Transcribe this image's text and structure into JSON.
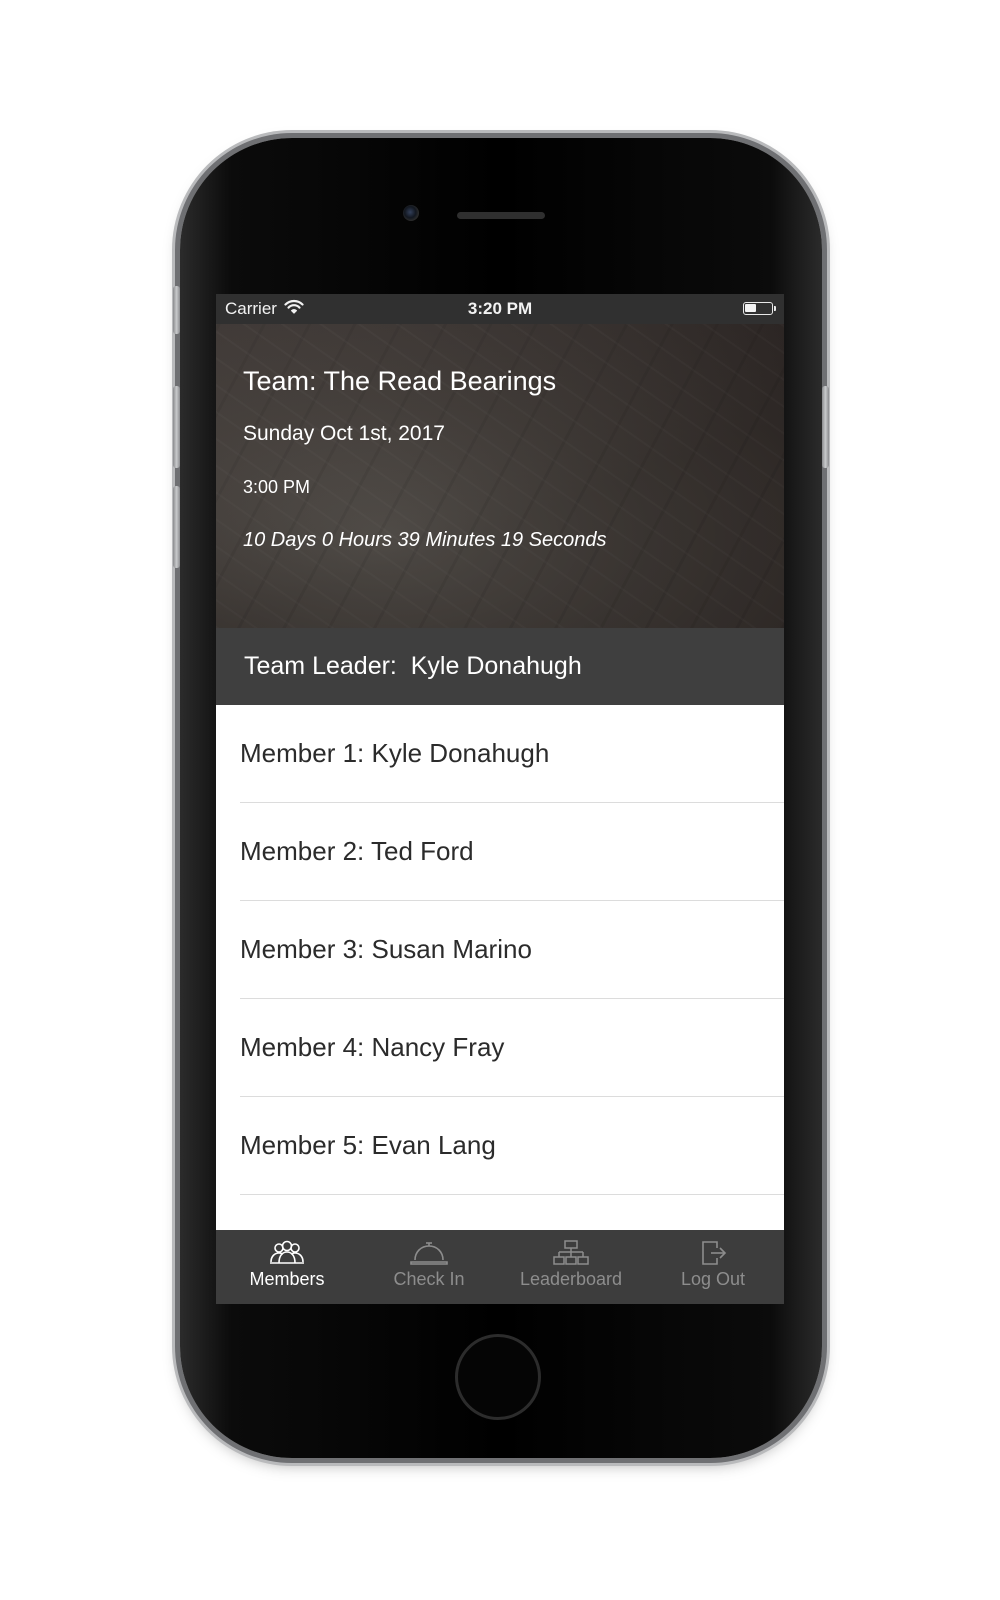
{
  "status_bar": {
    "carrier": "Carrier",
    "time": "3:20 PM",
    "battery_level": 0.45
  },
  "hero": {
    "team": "Team: The Read Bearings",
    "date": "Sunday Oct 1st, 2017",
    "time": "3:00 PM",
    "countdown": "10 Days 0 Hours 39 Minutes 19 Seconds"
  },
  "leader": {
    "label": "Team Leader:  Kyle Donahugh"
  },
  "members": [
    {
      "label": "Member 1: Kyle Donahugh"
    },
    {
      "label": "Member 2: Ted Ford"
    },
    {
      "label": "Member 3: Susan Marino"
    },
    {
      "label": "Member 4: Nancy Fray"
    },
    {
      "label": "Member 5: Evan Lang"
    }
  ],
  "tabs": [
    {
      "label": "Members",
      "icon": "members-icon",
      "active": true
    },
    {
      "label": "Check In",
      "icon": "bell-icon",
      "active": false
    },
    {
      "label": "Leaderboard",
      "icon": "hierarchy-icon",
      "active": false
    },
    {
      "label": "Log Out",
      "icon": "logout-icon",
      "active": false
    }
  ],
  "colors": {
    "status_bar": "#303030",
    "leader_bar": "#3f3f3f",
    "tab_bar": "#3d3d3d",
    "tab_active": "#ffffff",
    "tab_inactive": "#8d8d8d"
  }
}
